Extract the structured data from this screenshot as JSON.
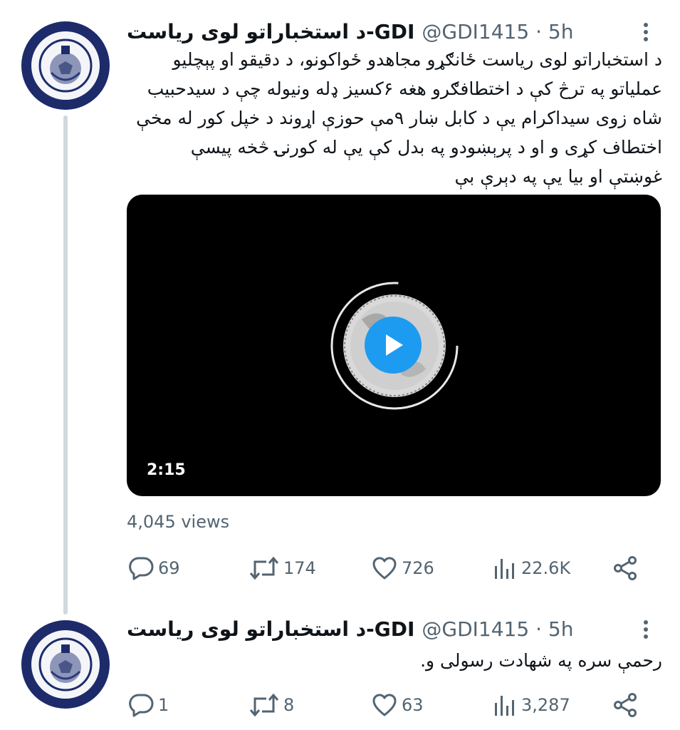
{
  "colors": {
    "accent": "#1d9bf0",
    "text": "#0f1419",
    "muted": "#536471",
    "thread_line": "#cfd9de",
    "avatar_ring": "#1d2b6b"
  },
  "tweets": [
    {
      "author_name": "د استخباراتو لوی ریاست-GDI",
      "handle_time": "@GDI1415 · 5h",
      "lines": [
        "د استخباراتو لوی ریاست ځانګړو مجاهدو ځواکونو، د دقیقو او پېچلیو",
        "عملیاتو په ترڅ کې د اختطافګرو هغه ۶کسیز ډله ونیوله چې د سیدحبیب",
        "شاه زوی سیداکرام یې د کابل ښار ۹مې حوزې اړوند د خپل کور له مخې",
        "اختطاف کړی و او د پرېښودو په بدل کې یې له کورنۍ څخه پیسې",
        "غوښتې او بیا یې په دېرې بې"
      ],
      "video": {
        "duration": "2:15",
        "icon": "play-icon"
      },
      "views": "4,045 views",
      "actions": {
        "replies": "69",
        "retweets": "174",
        "likes": "726",
        "analytics": "22.6K"
      }
    },
    {
      "author_name": "د استخباراتو لوی ریاست-GDI",
      "handle_time": "@GDI1415 · 5h",
      "lines": [
        "رحمې سره په شهادت رسولی و."
      ],
      "actions": {
        "replies": "1",
        "retweets": "8",
        "likes": "63",
        "analytics": "3,287"
      }
    }
  ]
}
